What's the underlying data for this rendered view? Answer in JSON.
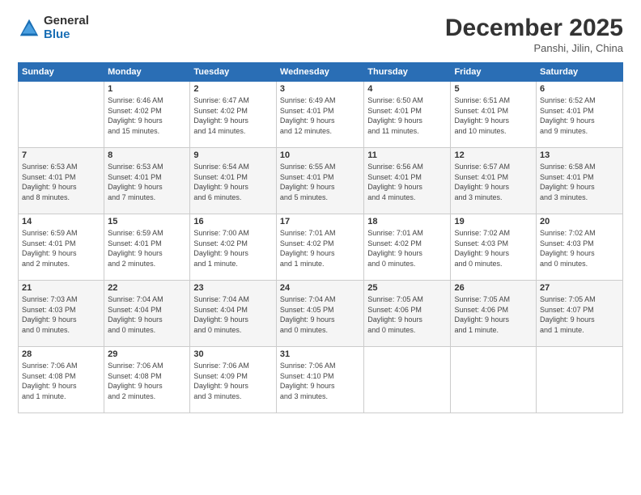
{
  "logo": {
    "general": "General",
    "blue": "Blue"
  },
  "title": "December 2025",
  "location": "Panshi, Jilin, China",
  "days_of_week": [
    "Sunday",
    "Monday",
    "Tuesday",
    "Wednesday",
    "Thursday",
    "Friday",
    "Saturday"
  ],
  "weeks": [
    [
      {
        "day": "",
        "info": ""
      },
      {
        "day": "1",
        "info": "Sunrise: 6:46 AM\nSunset: 4:02 PM\nDaylight: 9 hours\nand 15 minutes."
      },
      {
        "day": "2",
        "info": "Sunrise: 6:47 AM\nSunset: 4:02 PM\nDaylight: 9 hours\nand 14 minutes."
      },
      {
        "day": "3",
        "info": "Sunrise: 6:49 AM\nSunset: 4:01 PM\nDaylight: 9 hours\nand 12 minutes."
      },
      {
        "day": "4",
        "info": "Sunrise: 6:50 AM\nSunset: 4:01 PM\nDaylight: 9 hours\nand 11 minutes."
      },
      {
        "day": "5",
        "info": "Sunrise: 6:51 AM\nSunset: 4:01 PM\nDaylight: 9 hours\nand 10 minutes."
      },
      {
        "day": "6",
        "info": "Sunrise: 6:52 AM\nSunset: 4:01 PM\nDaylight: 9 hours\nand 9 minutes."
      }
    ],
    [
      {
        "day": "7",
        "info": "Sunrise: 6:53 AM\nSunset: 4:01 PM\nDaylight: 9 hours\nand 8 minutes."
      },
      {
        "day": "8",
        "info": "Sunrise: 6:53 AM\nSunset: 4:01 PM\nDaylight: 9 hours\nand 7 minutes."
      },
      {
        "day": "9",
        "info": "Sunrise: 6:54 AM\nSunset: 4:01 PM\nDaylight: 9 hours\nand 6 minutes."
      },
      {
        "day": "10",
        "info": "Sunrise: 6:55 AM\nSunset: 4:01 PM\nDaylight: 9 hours\nand 5 minutes."
      },
      {
        "day": "11",
        "info": "Sunrise: 6:56 AM\nSunset: 4:01 PM\nDaylight: 9 hours\nand 4 minutes."
      },
      {
        "day": "12",
        "info": "Sunrise: 6:57 AM\nSunset: 4:01 PM\nDaylight: 9 hours\nand 3 minutes."
      },
      {
        "day": "13",
        "info": "Sunrise: 6:58 AM\nSunset: 4:01 PM\nDaylight: 9 hours\nand 3 minutes."
      }
    ],
    [
      {
        "day": "14",
        "info": "Sunrise: 6:59 AM\nSunset: 4:01 PM\nDaylight: 9 hours\nand 2 minutes."
      },
      {
        "day": "15",
        "info": "Sunrise: 6:59 AM\nSunset: 4:01 PM\nDaylight: 9 hours\nand 2 minutes."
      },
      {
        "day": "16",
        "info": "Sunrise: 7:00 AM\nSunset: 4:02 PM\nDaylight: 9 hours\nand 1 minute."
      },
      {
        "day": "17",
        "info": "Sunrise: 7:01 AM\nSunset: 4:02 PM\nDaylight: 9 hours\nand 1 minute."
      },
      {
        "day": "18",
        "info": "Sunrise: 7:01 AM\nSunset: 4:02 PM\nDaylight: 9 hours\nand 0 minutes."
      },
      {
        "day": "19",
        "info": "Sunrise: 7:02 AM\nSunset: 4:03 PM\nDaylight: 9 hours\nand 0 minutes."
      },
      {
        "day": "20",
        "info": "Sunrise: 7:02 AM\nSunset: 4:03 PM\nDaylight: 9 hours\nand 0 minutes."
      }
    ],
    [
      {
        "day": "21",
        "info": "Sunrise: 7:03 AM\nSunset: 4:03 PM\nDaylight: 9 hours\nand 0 minutes."
      },
      {
        "day": "22",
        "info": "Sunrise: 7:04 AM\nSunset: 4:04 PM\nDaylight: 9 hours\nand 0 minutes."
      },
      {
        "day": "23",
        "info": "Sunrise: 7:04 AM\nSunset: 4:04 PM\nDaylight: 9 hours\nand 0 minutes."
      },
      {
        "day": "24",
        "info": "Sunrise: 7:04 AM\nSunset: 4:05 PM\nDaylight: 9 hours\nand 0 minutes."
      },
      {
        "day": "25",
        "info": "Sunrise: 7:05 AM\nSunset: 4:06 PM\nDaylight: 9 hours\nand 0 minutes."
      },
      {
        "day": "26",
        "info": "Sunrise: 7:05 AM\nSunset: 4:06 PM\nDaylight: 9 hours\nand 1 minute."
      },
      {
        "day": "27",
        "info": "Sunrise: 7:05 AM\nSunset: 4:07 PM\nDaylight: 9 hours\nand 1 minute."
      }
    ],
    [
      {
        "day": "28",
        "info": "Sunrise: 7:06 AM\nSunset: 4:08 PM\nDaylight: 9 hours\nand 1 minute."
      },
      {
        "day": "29",
        "info": "Sunrise: 7:06 AM\nSunset: 4:08 PM\nDaylight: 9 hours\nand 2 minutes."
      },
      {
        "day": "30",
        "info": "Sunrise: 7:06 AM\nSunset: 4:09 PM\nDaylight: 9 hours\nand 3 minutes."
      },
      {
        "day": "31",
        "info": "Sunrise: 7:06 AM\nSunset: 4:10 PM\nDaylight: 9 hours\nand 3 minutes."
      },
      {
        "day": "",
        "info": ""
      },
      {
        "day": "",
        "info": ""
      },
      {
        "day": "",
        "info": ""
      }
    ]
  ]
}
